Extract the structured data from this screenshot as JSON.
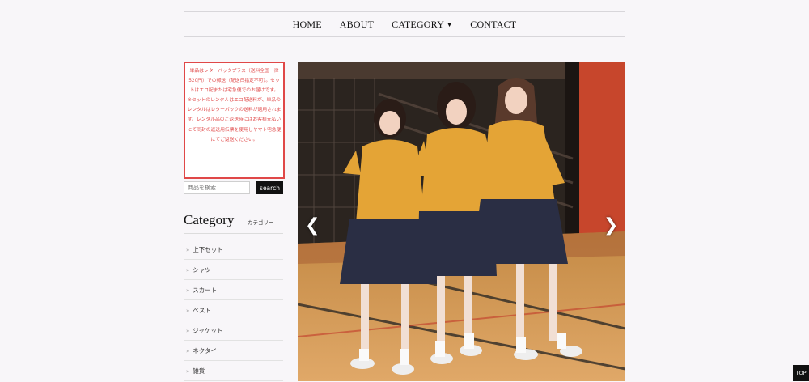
{
  "nav": {
    "items": [
      {
        "label": "HOME"
      },
      {
        "label": "ABOUT"
      },
      {
        "label": "CATEGORY"
      },
      {
        "label": "CONTACT"
      }
    ]
  },
  "notice": {
    "para1": "単品はレターパックプラス（送料全国一律520円）での郵送（配送日指定不可）。セットはエコ配または宅急便でのお届けです。",
    "para2": "※セットのレンタルはエコ配送料が、単品のレンタルはレターパックの送料が適用されます。レンタル品のご返送時にはお客様元払いにて同封の返送用伝票を使用しヤマト宅急便にてご返送ください。"
  },
  "search": {
    "placeholder": "商品を検索",
    "button": "search"
  },
  "category": {
    "title": "Category",
    "subtitle": "カテゴリー",
    "items": [
      {
        "label": "上下セット"
      },
      {
        "label": "シャツ"
      },
      {
        "label": "スカート"
      },
      {
        "label": "ベスト"
      },
      {
        "label": "ジャケット"
      },
      {
        "label": "ネクタイ"
      },
      {
        "label": "雑貨"
      }
    ]
  },
  "slider": {
    "prev": "❮",
    "next": "❯"
  },
  "top_button": "TOP"
}
